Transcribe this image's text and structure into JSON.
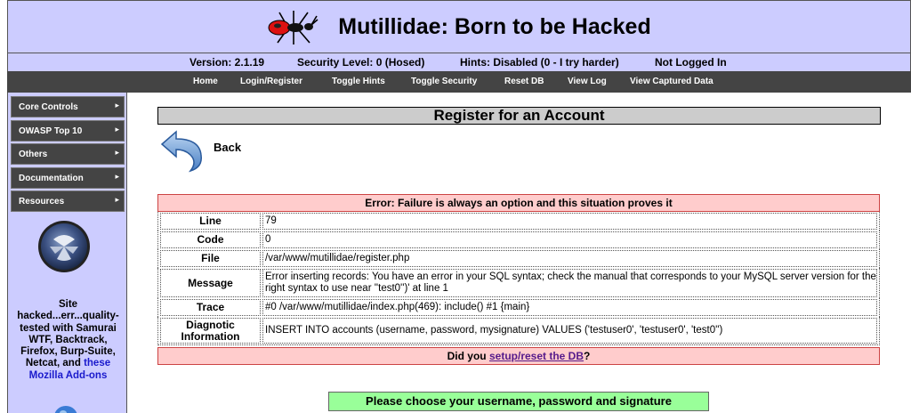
{
  "header": {
    "title": "Mutillidae: Born to be Hacked"
  },
  "info": {
    "version": "Version: 2.1.19",
    "security": "Security Level: 0 (Hosed)",
    "hints": "Hints: Disabled (0 - I try harder)",
    "login_status": "Not Logged In"
  },
  "nav": {
    "items": [
      "Home",
      "Login/Register",
      "Toggle Hints",
      "Toggle Security",
      "Reset DB",
      "View Log",
      "View Captured Data"
    ]
  },
  "sidebar": {
    "menu": [
      "Core Controls",
      "OWASP Top 10",
      "Others",
      "Documentation",
      "Resources"
    ],
    "text_main": "Site hacked...err...quality-tested with Samurai WTF, Backtrack, Firefox, Burp-Suite, Netcat, and",
    "text_link": "these Mozilla Add-ons"
  },
  "main": {
    "title": "Register for an Account",
    "back_label": "Back",
    "error": {
      "header": "Error: Failure is always an option and this situation proves it",
      "rows": [
        {
          "label": "Line",
          "value": "79"
        },
        {
          "label": "Code",
          "value": "0"
        },
        {
          "label": "File",
          "value": "/var/www/mutillidae/register.php"
        },
        {
          "label": "Message",
          "value": "Error inserting records: You have an error in your SQL syntax; check the manual that corresponds to your MySQL server version for the right syntax to use near ''test0'')' at line 1"
        },
        {
          "label": "Trace",
          "value": "#0 /var/www/mutillidae/index.php(469): include() #1 {main}"
        },
        {
          "label": "Diagnotic Information",
          "value": "INSERT INTO accounts (username, password, mysignature) VALUES ('testuser0', 'testuser0', 'test0'')"
        }
      ],
      "footer_prefix": "Did you",
      "footer_link": "setup/reset the DB",
      "footer_suffix": "?"
    },
    "choose_prompt": "Please choose your username, password and signature"
  },
  "icons": {
    "logo": "ant-logo-icon",
    "back": "back-arrow-icon",
    "owasp": "owasp-wasp-icon",
    "menu_arrow": "chevron-right-icon"
  },
  "colors": {
    "header_bg": "#ccccff",
    "nav_bg": "#444444",
    "title_bg": "#cccccc",
    "error_bg": "#ffcccc",
    "prompt_bg": "#99ff99"
  }
}
